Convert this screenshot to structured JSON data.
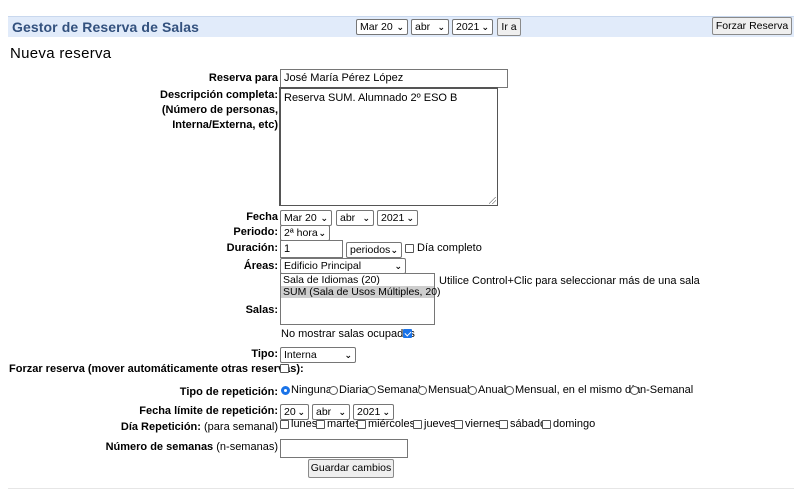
{
  "header": {
    "title": "Gestor de Reserva de Salas",
    "nav_day": "Mar 20",
    "nav_month": "abr",
    "nav_year": "2021",
    "go_button": "Ir a",
    "force_button": "Forzar Reserva"
  },
  "form": {
    "heading": "Nueva reserva",
    "reserve_for_label": "Reserva para",
    "reserve_for_value": "José María Pérez López",
    "description_label_1": "Descripción completa:",
    "description_label_2": "(Número de personas,",
    "description_label_3": "Interna/Externa, etc)",
    "description_value": "Reserva SUM. Alumnado 2º ESO B",
    "date_label": "Fecha",
    "date_day": "Mar 20",
    "date_month": "abr",
    "date_year": "2021",
    "period_label": "Periodo:",
    "period_value": "2ª hora",
    "duration_label": "Duración:",
    "duration_value": "1",
    "duration_unit": "periodos",
    "full_day_label": "Día completo",
    "areas_label": "Áreas:",
    "areas_value": "Edificio Principal",
    "rooms_label": "Salas:",
    "rooms_options": [
      "Sala de Idiomas (20)",
      "SUM (Sala de Usos Múltiples, 20)"
    ],
    "rooms_hint": "Utilice Control+Clic para seleccionar más de una sala",
    "hide_occupied_label": "No mostrar salas ocupadas",
    "hide_occupied_checked": true,
    "type_label": "Tipo:",
    "type_value": "Interna",
    "force_label": "Forzar reserva (mover automáticamente otras reservas):",
    "repeat_type_label": "Tipo de repetición:",
    "repeat_options": [
      "Ninguna",
      "Diaria",
      "Semanal",
      "Mensual",
      "Anual",
      "Mensual, en el mismo día",
      "n-Semanal"
    ],
    "repeat_selected": "Ninguna",
    "repeat_end_label": "Fecha límite de repetición:",
    "repeat_end_day": "20",
    "repeat_end_month": "abr",
    "repeat_end_year": "2021",
    "repeat_day_label": "Día Repetición:",
    "repeat_day_note": "(para semanal)",
    "weekdays": [
      "lunes",
      "martes",
      "miércoles",
      "jueves",
      "viernes",
      "sábado",
      "domingo"
    ],
    "weeks_label": "Número de semanas",
    "weeks_note": "(n-semanas)",
    "weeks_value": "",
    "save_button": "Guardar cambios"
  },
  "colors": {
    "header_bg": "#e1ebfa",
    "title_color": "#33517e",
    "accent": "#1a73e8"
  }
}
